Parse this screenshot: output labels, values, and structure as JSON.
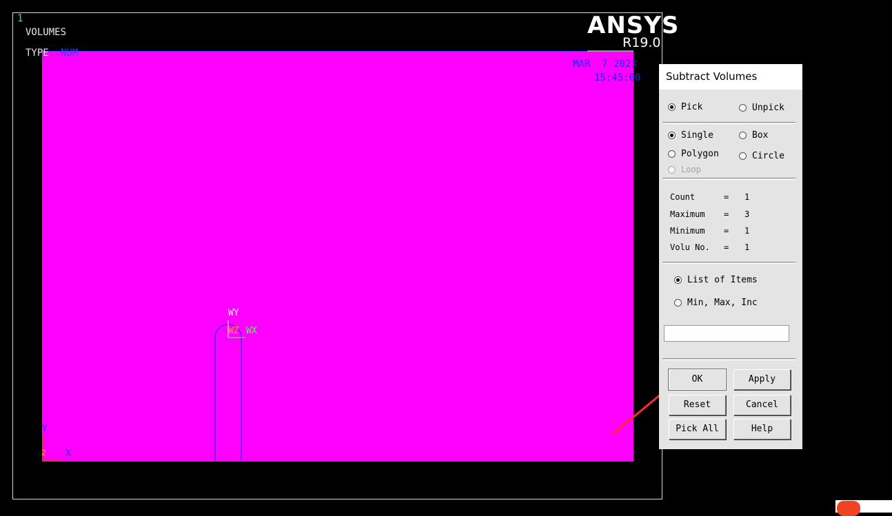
{
  "graphics": {
    "window_number": "1",
    "plot_title": "VOLUMES",
    "type_label": "TYPE",
    "type_value": "NUM",
    "logo": "ANSYS",
    "version": "R19.0",
    "date": "MAR  7 2023",
    "time": "15:45:00",
    "workplane_labels": {
      "wy": "WY",
      "wz": "WZ",
      "wx": "WX"
    },
    "global_axes": {
      "y": "Y",
      "z": "Z",
      "x": "X"
    },
    "colors": {
      "volume": "#ff00ff",
      "background": "#000000",
      "lines": "#2222ff"
    }
  },
  "dialog": {
    "title": "Subtract Volumes",
    "pick_mode": {
      "pick": "Pick",
      "unpick": "Unpick",
      "selected": "pick"
    },
    "pick_shape": {
      "single": "Single",
      "box": "Box",
      "polygon": "Polygon",
      "circle": "Circle",
      "loop": "Loop",
      "selected": "single"
    },
    "stats": [
      {
        "label": "Count",
        "value": "1"
      },
      {
        "label": "Maximum",
        "value": "3"
      },
      {
        "label": "Minimum",
        "value": "1"
      },
      {
        "label": "Volu No.",
        "value": "1"
      }
    ],
    "list_mode": {
      "list": "List of Items",
      "minmax": "Min, Max, Inc",
      "selected": "list"
    },
    "entry_value": "",
    "buttons": {
      "ok": "OK",
      "apply": "Apply",
      "reset": "Reset",
      "cancel": "Cancel",
      "pick_all": "Pick All",
      "help": "Help"
    }
  },
  "annotation": {
    "arrow_color": "#ff2a2a",
    "points_to": "OK"
  }
}
